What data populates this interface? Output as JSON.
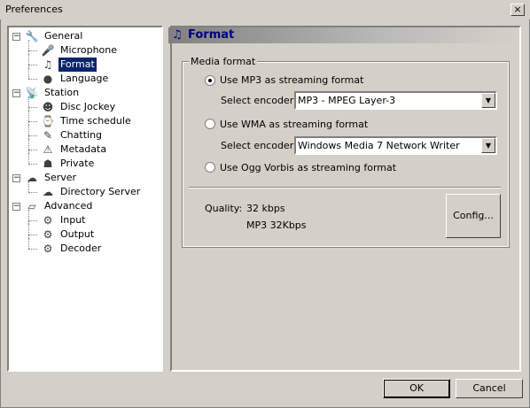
{
  "window": {
    "title": "Preferences",
    "close_glyph": "×"
  },
  "tree": [
    {
      "label": "General",
      "level": 0,
      "expander": "−",
      "icon": "general-icon",
      "glyph": "🔧"
    },
    {
      "label": "Microphone",
      "level": 1,
      "icon": "microphone-icon",
      "glyph": "🎤"
    },
    {
      "label": "Format",
      "level": 1,
      "icon": "music-note-icon",
      "glyph": "♫",
      "selected": true
    },
    {
      "label": "Language",
      "level": 1,
      "icon": "globe-icon",
      "glyph": "●"
    },
    {
      "label": "Station",
      "level": 0,
      "expander": "−",
      "icon": "station-icon",
      "glyph": "📡"
    },
    {
      "label": "Disc Jockey",
      "level": 1,
      "icon": "disc-jockey-icon",
      "glyph": "☻"
    },
    {
      "label": "Time schedule",
      "level": 1,
      "icon": "clock-icon",
      "glyph": "⌚"
    },
    {
      "label": "Chatting",
      "level": 1,
      "icon": "chat-icon",
      "glyph": "✎"
    },
    {
      "label": "Metadata",
      "level": 1,
      "icon": "metadata-icon",
      "glyph": "⚠"
    },
    {
      "label": "Private",
      "level": 1,
      "icon": "private-icon",
      "glyph": "☗"
    },
    {
      "label": "Server",
      "level": 0,
      "expander": "−",
      "icon": "server-icon",
      "glyph": "☁"
    },
    {
      "label": "Directory Server",
      "level": 1,
      "icon": "directory-server-icon",
      "glyph": "☁"
    },
    {
      "label": "Advanced",
      "level": 0,
      "expander": "−",
      "icon": "advanced-icon",
      "glyph": "▱"
    },
    {
      "label": "Input",
      "level": 1,
      "icon": "input-gear-icon",
      "glyph": "⚙"
    },
    {
      "label": "Output",
      "level": 1,
      "icon": "output-gear-icon",
      "glyph": "⚙"
    },
    {
      "label": "Decoder",
      "level": 1,
      "icon": "decoder-gear-icon",
      "glyph": "⚙"
    }
  ],
  "panel": {
    "header_icon": "♫",
    "title": "Format",
    "group_label": "Media format",
    "mp3": {
      "label": "Use MP3 as streaming format",
      "checked": true,
      "encoder_label": "Select encoder:",
      "encoder_value": "MP3 - MPEG Layer-3"
    },
    "wma": {
      "label": "Use WMA as streaming format",
      "checked": false,
      "encoder_label": "Select encoder:",
      "encoder_value": "Windows Media 7 Network Writer"
    },
    "ogg": {
      "label": "Use Ogg Vorbis as streaming format",
      "checked": false
    },
    "quality_label": "Quality:",
    "quality_value": "32 kbps",
    "quality_desc": "MP3 32Kbps",
    "config_label": "Config...",
    "dropdown_arrow": "▼"
  },
  "footer": {
    "ok_label": "OK",
    "cancel_label": "Cancel"
  }
}
